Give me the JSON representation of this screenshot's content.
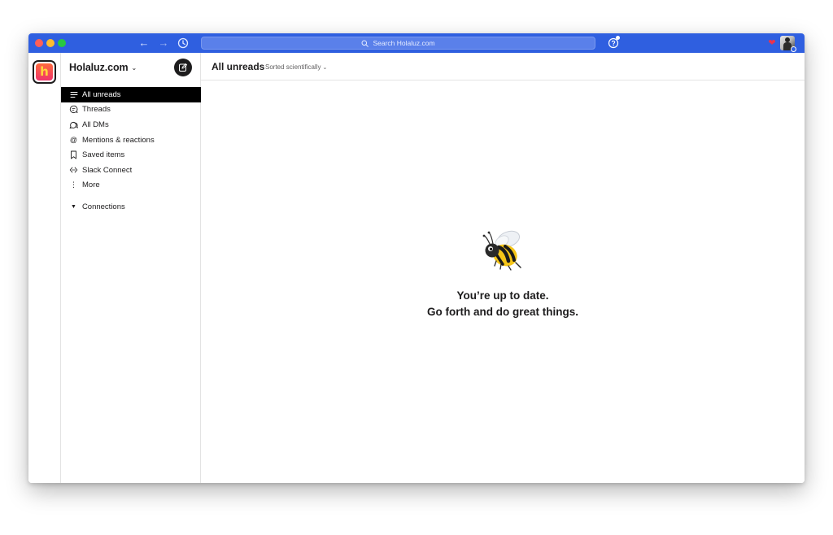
{
  "search": {
    "placeholder": "Search Holaluz.com"
  },
  "workspace": {
    "name": "Holaluz.com",
    "letter": "h"
  },
  "sidebar": {
    "items": [
      {
        "label": "All unreads",
        "icon": "lines-icon",
        "active": true
      },
      {
        "label": "Threads",
        "icon": "threads-icon"
      },
      {
        "label": "All DMs",
        "icon": "dms-icon"
      },
      {
        "label": "Mentions & reactions",
        "icon": "at-icon"
      },
      {
        "label": "Saved items",
        "icon": "bookmark-icon"
      },
      {
        "label": "Slack Connect",
        "icon": "slack-connect-icon"
      },
      {
        "label": "More",
        "icon": "more-vertical-icon"
      }
    ],
    "section": {
      "label": "Connections"
    }
  },
  "main": {
    "title": "All unreads",
    "sort_label": "Sorted scientifically",
    "empty_line1": "You’re up to date.",
    "empty_line2": "Go forth and do great things."
  },
  "colors": {
    "titlebar": "#2f5fe0",
    "active_item": "#000000",
    "workspace_gradient_top": "#ff6a3d",
    "workspace_gradient_bottom": "#f0356b"
  }
}
